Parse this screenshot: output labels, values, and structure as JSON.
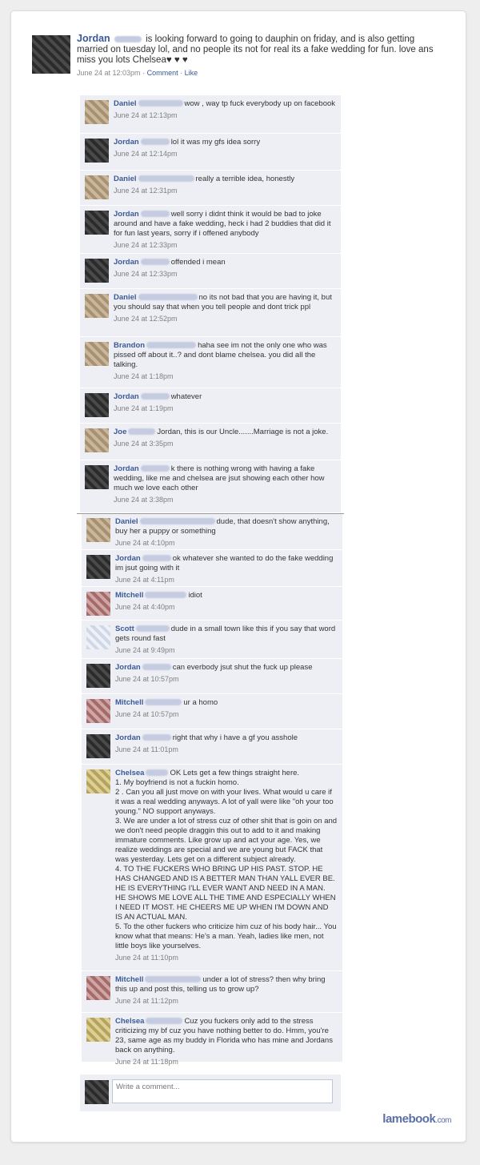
{
  "post": {
    "author": "Jordan",
    "text": "is looking forward to going to dauphin on friday, and is also getting married on tuesday lol, and no people its not for real its a fake wedding for fun. love ans miss you lots Chelsea♥ ♥ ♥",
    "timestamp": "June 24 at 12:03pm",
    "comment_link": "Comment",
    "like_link": "Like",
    "separator": "·"
  },
  "comments": [
    {
      "name": "Daniel",
      "text": "wow , way tp fuck everybody up on facebook",
      "time": "June 24 at 12:13pm"
    },
    {
      "name": "Jordan",
      "text": "lol it was my gfs idea sorry",
      "time": "June 24 at 12:14pm"
    },
    {
      "name": "Daniel",
      "text": "really a terrible idea, honestly",
      "time": "June 24 at 12:31pm"
    },
    {
      "name": "Jordan",
      "text": "well sorry i didnt think it would be bad to joke around and have a fake wedding, heck i had 2 buddies that did it for fun last years, sorry if i offened anybody",
      "time": "June 24 at 12:33pm"
    },
    {
      "name": "Jordan",
      "text": "offended i mean",
      "time": "June 24 at 12:33pm"
    },
    {
      "name": "Daniel",
      "text": "no its not bad that you are having it, but you should say that when you tell people and dont trick ppl",
      "time": "June 24 at 12:52pm"
    },
    {
      "name": "Brandon",
      "text": "haha see im not the only one who was pissed off about it..? and dont blame chelsea. you did all the talking.",
      "time": "June 24 at 1:18pm"
    },
    {
      "name": "Jordan",
      "text": "whatever",
      "time": "June 24 at 1:19pm"
    },
    {
      "name": "Joe",
      "text": "Jordan, this is our Uncle.......Marriage is not a joke.",
      "time": "June 24 at 3:35pm"
    },
    {
      "name": "Jordan",
      "text": "k there is nothing wrong with having a fake wedding, like me and chelsea are jsut showing each other how much we love each other",
      "time": "June 24 at 3:38pm"
    },
    {
      "name": "Daniel",
      "text": "dude, that doesn't show anything, buy her a puppy or something",
      "time": "June 24 at 4:10pm"
    },
    {
      "name": "Jordan",
      "text": "ok whatever she wanted to do the fake wedding im jsut going with it",
      "time": "June 24 at 4:11pm"
    },
    {
      "name": "Mitchell",
      "text": "idiot",
      "time": "June 24 at 4:40pm"
    },
    {
      "name": "Scott",
      "text": "dude in a small town like this if you say that word gets round fast",
      "time": "June 24 at 9:49pm"
    },
    {
      "name": "Jordan",
      "text": "can everbody jsut shut the fuck up please",
      "time": "June 24 at 10:57pm"
    },
    {
      "name": "Mitchell",
      "text": "ur a homo",
      "time": "June 24 at 10:57pm"
    },
    {
      "name": "Jordan",
      "text": "right that why i have a gf you asshole",
      "time": "June 24 at 11:01pm"
    },
    {
      "name": "Chelsea",
      "text": "OK Lets get a few things straight here.\n1. My boyfriend is not a fuckin homo.\n2 . Can you all just move on with your lives. What would u care if it was a real wedding anyways. A lot of yall were like \"oh your too young.\" NO support anyways.\n3. We are under a lot of stress cuz of other shit that is goin on and we don't need people draggin this out to add to it and making immature comments. Like grow up and act your age. Yes, we realize weddings are special and we are young but FACK that was yesterday. Lets get on a different subject already.\n4. TO THE FUCKERS WHO BRING UP HIS PAST. STOP. HE HAS CHANGED AND IS A BETTER MAN THAN YALL EVER BE. HE IS EVERYTHING I'LL EVER WANT AND NEED IN A MAN. HE SHOWS ME LOVE ALL THE TIME AND ESPECIALLY WHEN I NEED IT MOST. HE CHEERS ME UP WHEN I'M DOWN AND IS AN ACTUAL MAN.\n5. To the other fuckers who criticize him cuz of his body hair... You know what that means: He's a man. Yeah, ladies like men, not little boys like yourselves.",
      "time": "June 24 at 11:10pm"
    },
    {
      "name": "Mitchell",
      "text": "under a lot of stress? then why bring this up and post this, telling us to grow up?",
      "time": "June 24 at 11:12pm"
    },
    {
      "name": "Chelsea",
      "text": "Cuz you fuckers only add to the stress criticizing my bf cuz you have nothing better to do. Hmm, you're 23, same age as my buddy in Florida who has mine and Jordans back on anything.",
      "time": "June 24 at 11:18pm"
    }
  ],
  "comment_input": {
    "placeholder": "Write a comment..."
  },
  "watermark": {
    "brand": "lamebook",
    "tld": ".com"
  }
}
